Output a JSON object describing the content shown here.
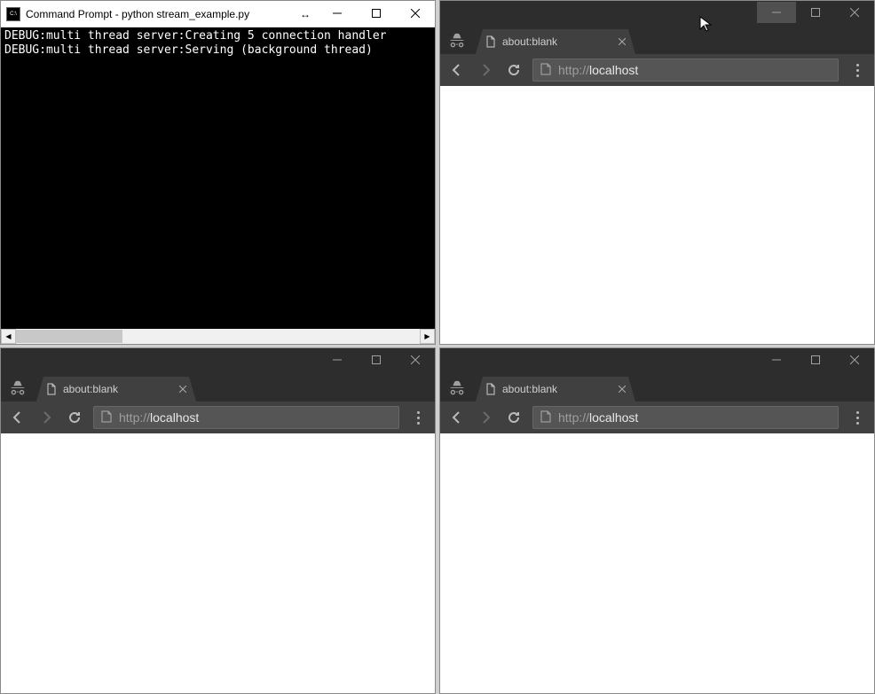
{
  "cmd": {
    "title": "Command Prompt - python  stream_example.py",
    "icon_label": "C:\\",
    "lines": [
      "DEBUG:multi thread server:Creating 5 connection handler",
      "DEBUG:multi thread server:Serving (background thread)"
    ]
  },
  "browser1": {
    "tab_title": "about:blank",
    "url_prefix": "http://",
    "url_host": "localhost"
  },
  "browser2": {
    "tab_title": "about:blank",
    "url_prefix": "http://",
    "url_host": "localhost"
  },
  "browser3": {
    "tab_title": "about:blank",
    "url_prefix": "http://",
    "url_host": "localhost"
  }
}
